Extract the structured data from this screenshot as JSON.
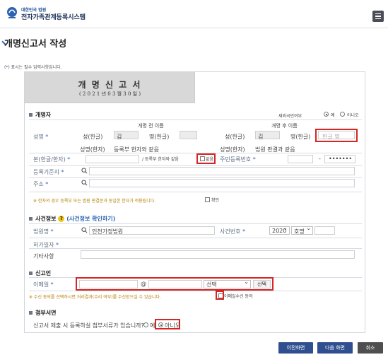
{
  "header": {
    "court_label": "대한민국 법원",
    "system_title": "전자가족관계등록시스템"
  },
  "page": {
    "title": "개명신고서 작성",
    "required_prefix": "(",
    "required_star": "*",
    "required_suffix": ") 표시는 필수 입력사항입니다."
  },
  "document": {
    "title": "개 명 신 고 서",
    "date": "( 2 0 2 1 년   0 3 월   3 0 일 )"
  },
  "applicant": {
    "section": "개명자",
    "foreign_question": "재외국민여부",
    "foreign_yes": "예",
    "foreign_no": "아니오",
    "before_header": "개명 전 이름",
    "after_header": "개명 후 이름",
    "name_label": "성명",
    "surname_label": "성(한글)",
    "surname_value": "김",
    "given_label": "명(한글)",
    "surname_label_after": "성(한글)",
    "surname_value_after": "김",
    "given_label_after": "명(한글)",
    "given_placeholder": "한글 명",
    "hanja_label": "성명(한자)",
    "hanja_value": "등록부 한자와 같음",
    "hanja_label_after": "성명(한자)",
    "hanja_value_after": "법원 판결과 같음",
    "origin_label": "본(한글/한자)",
    "origin_value": "/ 등록부 한자와 같음",
    "none_label": "없음",
    "resident_label": "주민등록번호",
    "resident_masked": "•••••••",
    "registry_label": "등록기준지",
    "address_label": "주소",
    "warning": "※ 한자의 경우 등록부 또는 법원 판결문과 동일한 한자가 적용됩니다.",
    "confirm_label": "확인"
  },
  "case": {
    "section": "사건정보",
    "help_link": "(사건정보 확인하기)",
    "court_label": "법원명",
    "court_value": "인천가정법원",
    "case_no_label": "사건번호",
    "year": "2020",
    "case_type": "호명",
    "permit_label": "허가일자",
    "other_label": "기타사항"
  },
  "reporter": {
    "section": "신고인",
    "email_label": "이메일",
    "at_sign": "@",
    "select_label": "선택",
    "select_button": "선택",
    "notice": "※ 수신 동의를 선택하시면 처리결과(수리 여부)를 수신받으실 수 있습니다.",
    "consent_label": "이메일수신 동의"
  },
  "attachments": {
    "section": "첨부서면",
    "question": "신고서 제출 시 등록하실 첨부서류가 있습니까?",
    "yes": "예",
    "no": "아니오"
  },
  "footer": {
    "prev": "이전화면",
    "next": "다음 화면",
    "cancel": "취소"
  },
  "colors": {
    "brand_blue": "#2f69b7",
    "highlight_red": "#d52525",
    "warning_text": "#b57f00"
  }
}
